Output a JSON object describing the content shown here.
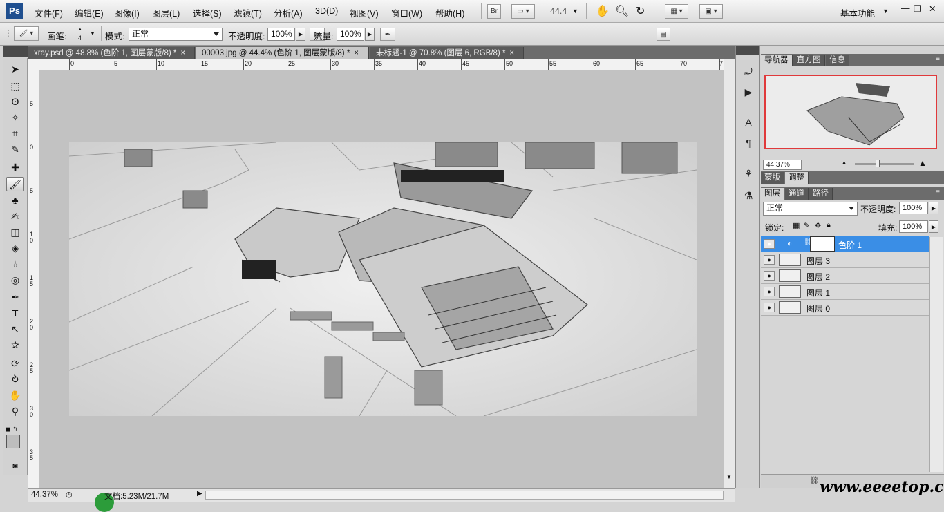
{
  "app": {
    "logo": "Ps",
    "workspace": "基本功能"
  },
  "menu": [
    "文件(F)",
    "编辑(E)",
    "图像(I)",
    "图层(L)",
    "选择(S)",
    "滤镜(T)",
    "分析(A)",
    "3D(D)",
    "视图(V)",
    "窗口(W)",
    "帮助(H)"
  ],
  "appbar": {
    "bridge": "Br",
    "zoom": "44.4"
  },
  "options": {
    "brush_label": "画笔:",
    "brush_size": "4",
    "mode_label": "模式:",
    "mode_value": "正常",
    "opacity_label": "不透明度:",
    "opacity_value": "100%",
    "flow_label": "流量:",
    "flow_value": "100%"
  },
  "tabs": [
    {
      "label": "xray.psd @ 48.8% (色阶 1, 图层蒙版/8) *",
      "close": "×"
    },
    {
      "label": "00003.jpg @ 44.4% (色阶 1, 图层蒙版/8) *",
      "close": "×"
    },
    {
      "label": "未标题-1 @ 70.8% (图层 6, RGB/8) *",
      "close": "×"
    }
  ],
  "ruler_h": [
    "0",
    "5",
    "10",
    "15",
    "20",
    "25",
    "30",
    "35",
    "40",
    "45",
    "50",
    "55",
    "60",
    "65",
    "70",
    "7"
  ],
  "ruler_v": [
    "5",
    "0",
    "5",
    "1 0",
    "1 5",
    "2 0",
    "2 5",
    "3 0",
    "3 5"
  ],
  "status": {
    "zoom": "44.37%",
    "doc": "文档:5.23M/21.7M"
  },
  "navigator": {
    "tabs": [
      "导航器",
      "直方图",
      "信息"
    ],
    "zoom": "44.37%"
  },
  "adjust_tabs": [
    "蒙版",
    "调整"
  ],
  "layers_panel": {
    "tabs": [
      "图层",
      "通道",
      "路径"
    ],
    "blend_mode": "正常",
    "opacity_label": "不透明度:",
    "opacity_value": "100%",
    "lock_label": "锁定:",
    "fill_label": "填充:",
    "fill_value": "100%",
    "layers": [
      {
        "name": "色阶 1",
        "selected": true
      },
      {
        "name": "图层 3",
        "selected": false
      },
      {
        "name": "图层 2",
        "selected": false
      },
      {
        "name": "图层 1",
        "selected": false
      },
      {
        "name": "图层 0",
        "selected": false
      }
    ]
  },
  "watermark": "www.eeeetop.com",
  "icons": {
    "tools": [
      "move-icon",
      "marquee-icon",
      "lasso-icon",
      "magic-wand-icon",
      "crop-icon",
      "eyedropper-icon",
      "healing-icon",
      "brush-icon",
      "stamp-icon",
      "history-brush-icon",
      "eraser-icon",
      "bucket-icon",
      "blur-icon",
      "dodge-icon",
      "pen-icon",
      "type-icon",
      "path-select-icon",
      "shape-icon",
      "3d-rotate-icon",
      "3d-orbit-icon",
      "hand-icon",
      "zoom-icon"
    ]
  }
}
